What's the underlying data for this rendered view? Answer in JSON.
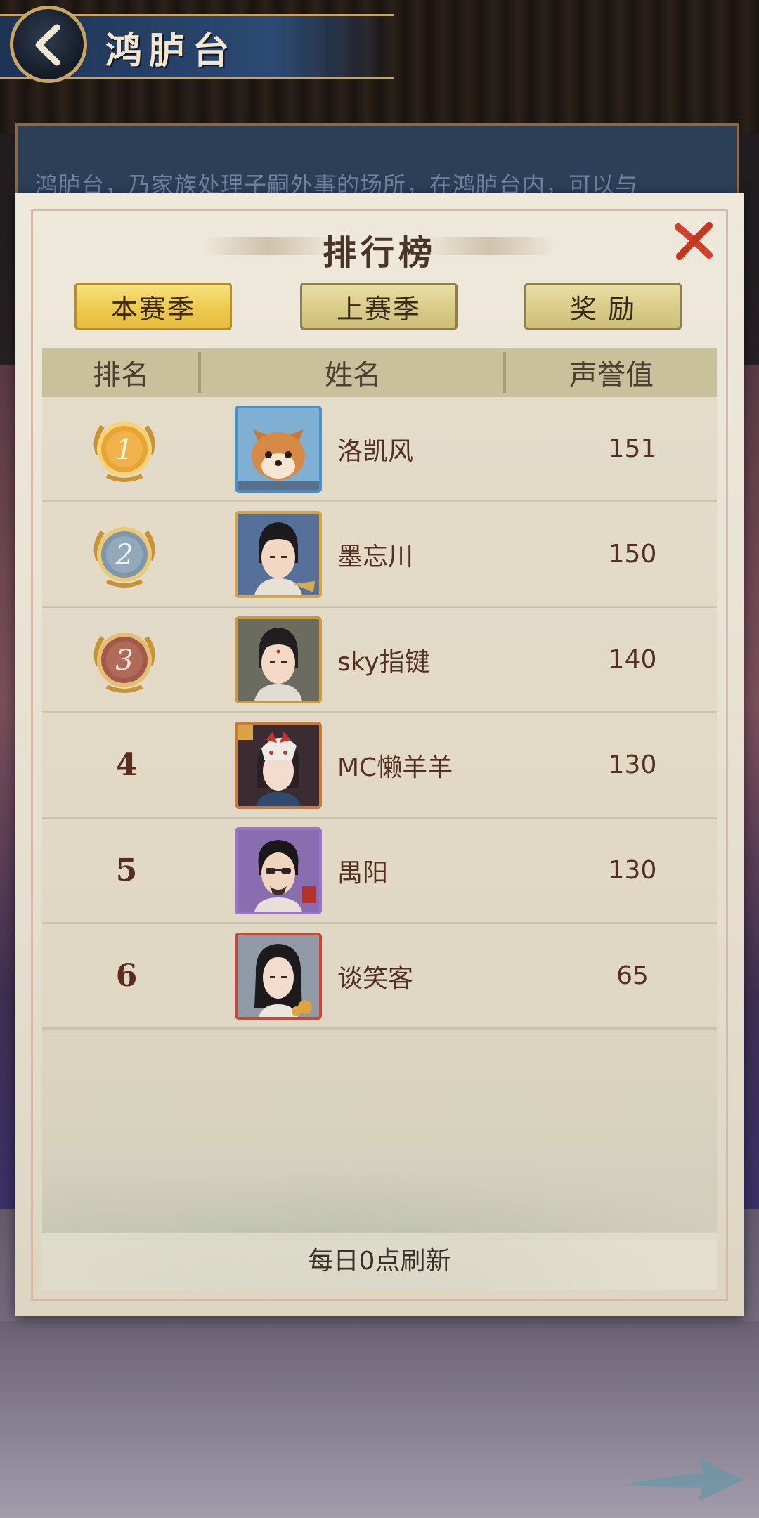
{
  "header": {
    "title": "鸿胪台",
    "background_text": "鸿胪台，乃家族处理子嗣外事的场所，在鸿胪台内，可以与"
  },
  "modal": {
    "title": "排行榜",
    "tabs": [
      {
        "label": "本赛季",
        "active": true
      },
      {
        "label": "上赛季",
        "active": false
      },
      {
        "label": "奖  励",
        "active": false
      }
    ],
    "columns": {
      "rank": "排名",
      "name": "姓名",
      "score": "声誉值"
    },
    "rows": [
      {
        "rank": "1",
        "medal": "gold-medal",
        "name": "洛凯风",
        "score": "151",
        "avatar": "shiba-dog-avatar"
      },
      {
        "rank": "2",
        "medal": "silver-medal",
        "name": "墨忘川",
        "score": "150",
        "avatar": "male-scholar-avatar"
      },
      {
        "rank": "3",
        "medal": "bronze-medal",
        "name": "sky指键",
        "score": "140",
        "avatar": "male-scholar-avatar"
      },
      {
        "rank": "4",
        "medal": null,
        "name": "MC懒羊羊",
        "score": "130",
        "avatar": "masked-lady-avatar"
      },
      {
        "rank": "5",
        "medal": null,
        "name": "禺阳",
        "score": "130",
        "avatar": "sunglasses-man-avatar"
      },
      {
        "rank": "6",
        "medal": null,
        "name": "谈笑客",
        "score": "65",
        "avatar": "long-hair-man-avatar"
      }
    ],
    "footer_note": "每日0点刷新"
  },
  "colors": {
    "gold_tab": "#ecc84c",
    "name_text": "#55301f",
    "close_red": "#d0402a"
  }
}
